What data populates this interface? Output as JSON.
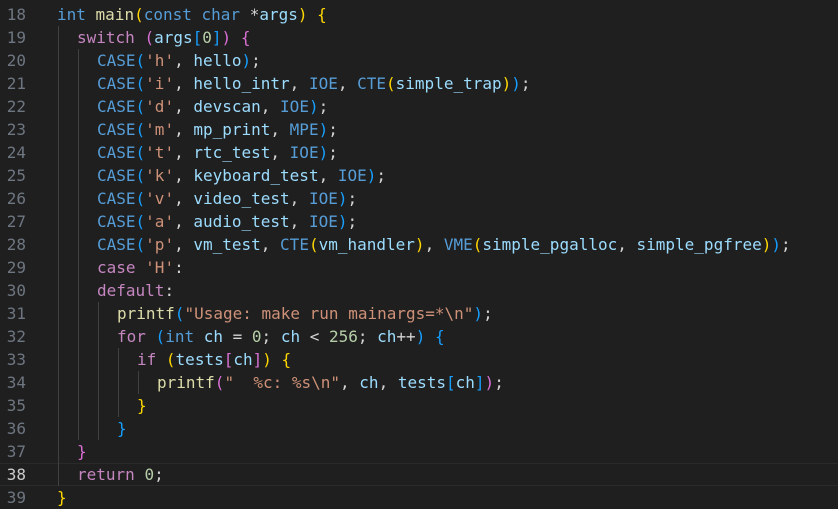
{
  "colors": {
    "background": "#1f1f1f",
    "line_number": "#6e7681",
    "line_number_active": "#cccccc",
    "keyword": "#569cd6",
    "control": "#c586c0",
    "function": "#dcdcaa",
    "macro": "#569cd6",
    "string": "#ce9178",
    "number": "#b5cea8",
    "identifier": "#9cdcfe",
    "plain": "#d4d4d4",
    "bracket1": "#ffd700",
    "bracket2": "#da70d6",
    "bracket3": "#179fff"
  },
  "active_line": 38,
  "lines": [
    {
      "n": "18",
      "indent": 0,
      "tokens": [
        [
          "int",
          "keyword"
        ],
        [
          " ",
          "plain"
        ],
        [
          "main",
          "function"
        ],
        [
          "(",
          "bracket1"
        ],
        [
          "const",
          "keyword"
        ],
        [
          " ",
          "plain"
        ],
        [
          "char",
          "keyword"
        ],
        [
          " *",
          "plain"
        ],
        [
          "args",
          "identifier"
        ],
        [
          ")",
          "bracket1"
        ],
        [
          " ",
          "plain"
        ],
        [
          "{",
          "bracket1"
        ]
      ]
    },
    {
      "n": "19",
      "indent": 1,
      "tokens": [
        [
          "switch",
          "control"
        ],
        [
          " ",
          "plain"
        ],
        [
          "(",
          "bracket2"
        ],
        [
          "args",
          "identifier"
        ],
        [
          "[",
          "bracket3"
        ],
        [
          "0",
          "number"
        ],
        [
          "]",
          "bracket3"
        ],
        [
          ")",
          "bracket2"
        ],
        [
          " ",
          "plain"
        ],
        [
          "{",
          "bracket2"
        ]
      ]
    },
    {
      "n": "20",
      "indent": 2,
      "tokens": [
        [
          "CASE",
          "macro"
        ],
        [
          "(",
          "bracket3"
        ],
        [
          "'h'",
          "string"
        ],
        [
          ", ",
          "plain"
        ],
        [
          "hello",
          "identifier"
        ],
        [
          ")",
          "bracket3"
        ],
        [
          ";",
          "plain"
        ]
      ]
    },
    {
      "n": "21",
      "indent": 2,
      "tokens": [
        [
          "CASE",
          "macro"
        ],
        [
          "(",
          "bracket3"
        ],
        [
          "'i'",
          "string"
        ],
        [
          ", ",
          "plain"
        ],
        [
          "hello_intr",
          "identifier"
        ],
        [
          ", ",
          "plain"
        ],
        [
          "IOE",
          "macro"
        ],
        [
          ", ",
          "plain"
        ],
        [
          "CTE",
          "macro"
        ],
        [
          "(",
          "bracket1"
        ],
        [
          "simple_trap",
          "identifier"
        ],
        [
          ")",
          "bracket1"
        ],
        [
          ")",
          "bracket3"
        ],
        [
          ";",
          "plain"
        ]
      ]
    },
    {
      "n": "22",
      "indent": 2,
      "tokens": [
        [
          "CASE",
          "macro"
        ],
        [
          "(",
          "bracket3"
        ],
        [
          "'d'",
          "string"
        ],
        [
          ", ",
          "plain"
        ],
        [
          "devscan",
          "identifier"
        ],
        [
          ", ",
          "plain"
        ],
        [
          "IOE",
          "macro"
        ],
        [
          ")",
          "bracket3"
        ],
        [
          ";",
          "plain"
        ]
      ]
    },
    {
      "n": "23",
      "indent": 2,
      "tokens": [
        [
          "CASE",
          "macro"
        ],
        [
          "(",
          "bracket3"
        ],
        [
          "'m'",
          "string"
        ],
        [
          ", ",
          "plain"
        ],
        [
          "mp_print",
          "identifier"
        ],
        [
          ", ",
          "plain"
        ],
        [
          "MPE",
          "macro"
        ],
        [
          ")",
          "bracket3"
        ],
        [
          ";",
          "plain"
        ]
      ]
    },
    {
      "n": "24",
      "indent": 2,
      "tokens": [
        [
          "CASE",
          "macro"
        ],
        [
          "(",
          "bracket3"
        ],
        [
          "'t'",
          "string"
        ],
        [
          ", ",
          "plain"
        ],
        [
          "rtc_test",
          "identifier"
        ],
        [
          ", ",
          "plain"
        ],
        [
          "IOE",
          "macro"
        ],
        [
          ")",
          "bracket3"
        ],
        [
          ";",
          "plain"
        ]
      ]
    },
    {
      "n": "25",
      "indent": 2,
      "tokens": [
        [
          "CASE",
          "macro"
        ],
        [
          "(",
          "bracket3"
        ],
        [
          "'k'",
          "string"
        ],
        [
          ", ",
          "plain"
        ],
        [
          "keyboard_test",
          "identifier"
        ],
        [
          ", ",
          "plain"
        ],
        [
          "IOE",
          "macro"
        ],
        [
          ")",
          "bracket3"
        ],
        [
          ";",
          "plain"
        ]
      ]
    },
    {
      "n": "26",
      "indent": 2,
      "tokens": [
        [
          "CASE",
          "macro"
        ],
        [
          "(",
          "bracket3"
        ],
        [
          "'v'",
          "string"
        ],
        [
          ", ",
          "plain"
        ],
        [
          "video_test",
          "identifier"
        ],
        [
          ", ",
          "plain"
        ],
        [
          "IOE",
          "macro"
        ],
        [
          ")",
          "bracket3"
        ],
        [
          ";",
          "plain"
        ]
      ]
    },
    {
      "n": "27",
      "indent": 2,
      "tokens": [
        [
          "CASE",
          "macro"
        ],
        [
          "(",
          "bracket3"
        ],
        [
          "'a'",
          "string"
        ],
        [
          ", ",
          "plain"
        ],
        [
          "audio_test",
          "identifier"
        ],
        [
          ", ",
          "plain"
        ],
        [
          "IOE",
          "macro"
        ],
        [
          ")",
          "bracket3"
        ],
        [
          ";",
          "plain"
        ]
      ]
    },
    {
      "n": "28",
      "indent": 2,
      "tokens": [
        [
          "CASE",
          "macro"
        ],
        [
          "(",
          "bracket3"
        ],
        [
          "'p'",
          "string"
        ],
        [
          ", ",
          "plain"
        ],
        [
          "vm_test",
          "identifier"
        ],
        [
          ", ",
          "plain"
        ],
        [
          "CTE",
          "macro"
        ],
        [
          "(",
          "bracket1"
        ],
        [
          "vm_handler",
          "identifier"
        ],
        [
          ")",
          "bracket1"
        ],
        [
          ", ",
          "plain"
        ],
        [
          "VME",
          "macro"
        ],
        [
          "(",
          "bracket1"
        ],
        [
          "simple_pgalloc",
          "identifier"
        ],
        [
          ", ",
          "plain"
        ],
        [
          "simple_pgfree",
          "identifier"
        ],
        [
          ")",
          "bracket1"
        ],
        [
          ")",
          "bracket3"
        ],
        [
          ";",
          "plain"
        ]
      ]
    },
    {
      "n": "29",
      "indent": 2,
      "tokens": [
        [
          "case",
          "control"
        ],
        [
          " ",
          "plain"
        ],
        [
          "'H'",
          "string"
        ],
        [
          ":",
          "plain"
        ]
      ]
    },
    {
      "n": "30",
      "indent": 2,
      "tokens": [
        [
          "default",
          "control"
        ],
        [
          ":",
          "plain"
        ]
      ]
    },
    {
      "n": "31",
      "indent": 3,
      "tokens": [
        [
          "printf",
          "function"
        ],
        [
          "(",
          "bracket3"
        ],
        [
          "\"Usage: make run mainargs=*\\n\"",
          "string"
        ],
        [
          ")",
          "bracket3"
        ],
        [
          ";",
          "plain"
        ]
      ]
    },
    {
      "n": "32",
      "indent": 3,
      "tokens": [
        [
          "for",
          "control"
        ],
        [
          " ",
          "plain"
        ],
        [
          "(",
          "bracket3"
        ],
        [
          "int",
          "keyword"
        ],
        [
          " ",
          "plain"
        ],
        [
          "ch",
          "identifier"
        ],
        [
          " = ",
          "plain"
        ],
        [
          "0",
          "number"
        ],
        [
          "; ",
          "plain"
        ],
        [
          "ch",
          "identifier"
        ],
        [
          " < ",
          "plain"
        ],
        [
          "256",
          "number"
        ],
        [
          "; ",
          "plain"
        ],
        [
          "ch",
          "identifier"
        ],
        [
          "++",
          "plain"
        ],
        [
          ")",
          "bracket3"
        ],
        [
          " ",
          "plain"
        ],
        [
          "{",
          "bracket3"
        ]
      ]
    },
    {
      "n": "33",
      "indent": 4,
      "tokens": [
        [
          "if",
          "control"
        ],
        [
          " ",
          "plain"
        ],
        [
          "(",
          "bracket1"
        ],
        [
          "tests",
          "identifier"
        ],
        [
          "[",
          "bracket2"
        ],
        [
          "ch",
          "identifier"
        ],
        [
          "]",
          "bracket2"
        ],
        [
          ")",
          "bracket1"
        ],
        [
          " ",
          "plain"
        ],
        [
          "{",
          "bracket1"
        ]
      ]
    },
    {
      "n": "34",
      "indent": 5,
      "tokens": [
        [
          "printf",
          "function"
        ],
        [
          "(",
          "bracket2"
        ],
        [
          "\"  %c: %s\\n\"",
          "string"
        ],
        [
          ", ",
          "plain"
        ],
        [
          "ch",
          "identifier"
        ],
        [
          ", ",
          "plain"
        ],
        [
          "tests",
          "identifier"
        ],
        [
          "[",
          "bracket3"
        ],
        [
          "ch",
          "identifier"
        ],
        [
          "]",
          "bracket3"
        ],
        [
          ")",
          "bracket2"
        ],
        [
          ";",
          "plain"
        ]
      ]
    },
    {
      "n": "35",
      "indent": 4,
      "tokens": [
        [
          "}",
          "bracket1"
        ]
      ]
    },
    {
      "n": "36",
      "indent": 3,
      "tokens": [
        [
          "}",
          "bracket3"
        ]
      ]
    },
    {
      "n": "37",
      "indent": 1,
      "tokens": [
        [
          "}",
          "bracket2"
        ]
      ]
    },
    {
      "n": "38",
      "indent": 1,
      "tokens": [
        [
          "return",
          "control"
        ],
        [
          " ",
          "plain"
        ],
        [
          "0",
          "number"
        ],
        [
          ";",
          "plain"
        ]
      ]
    },
    {
      "n": "39",
      "indent": 0,
      "tokens": [
        [
          "}",
          "bracket1"
        ]
      ]
    }
  ]
}
